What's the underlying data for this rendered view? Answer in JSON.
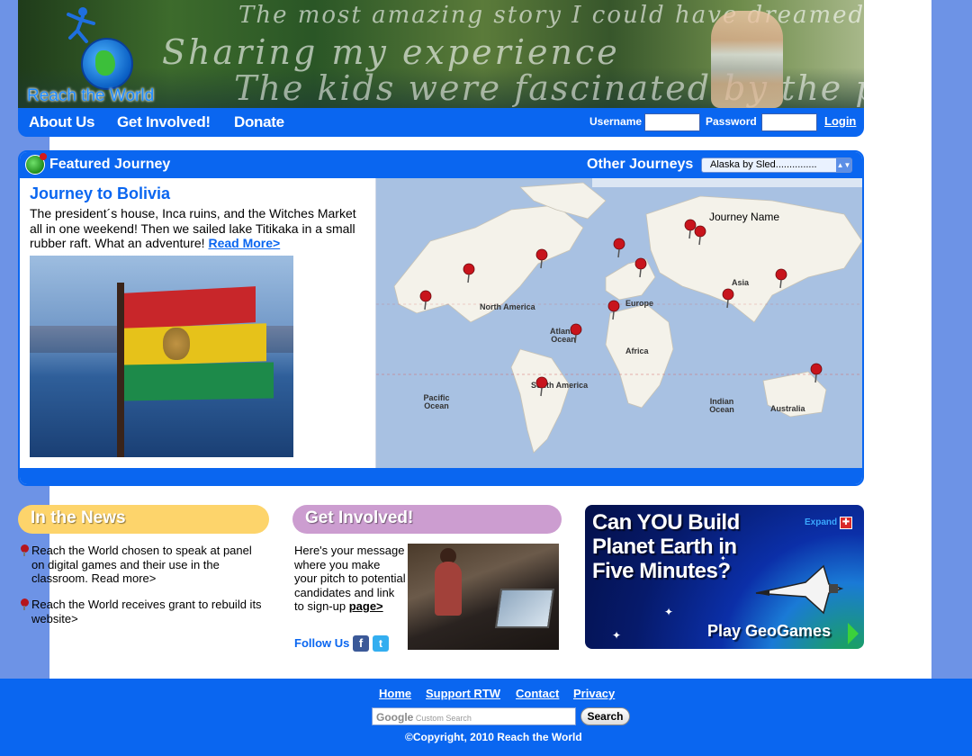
{
  "header": {
    "logo_text": "Reach the World",
    "banner_line1": "The most amazing story I could have dreamed of",
    "banner_line2": "Sharing my experience",
    "banner_line3": "The kids were fascinated by the person"
  },
  "nav": {
    "about": "About Us",
    "involved": "Get Involved!",
    "donate": "Donate",
    "username_label": "Username",
    "password_label": "Password",
    "login_label": "Login",
    "username_value": "",
    "password_value": ""
  },
  "featured": {
    "section_title": "Featured Journey",
    "other_title": "Other Journeys",
    "journey_select_value": "Alaska by Sled...............",
    "journey_heading": "Journey to Bolivia",
    "journey_text": "The president´s house, Inca ruins, and the Witches Market all in one weekend! Then we sailed lake Titikaka in a small rubber raft. What an adventure!",
    "read_more": "Read More>",
    "map_label_journey": "Journey Name",
    "map_labels": {
      "north_america": "North America",
      "south_america": "South America",
      "europe": "Europe",
      "africa": "Africa",
      "asia": "Asia",
      "australia": "Australia",
      "pacific": "Pacific Ocean",
      "atlantic": "Atlantic Ocean",
      "indian": "Indian Ocean"
    }
  },
  "news": {
    "title": "In the News",
    "items": [
      "Reach the World chosen to speak at panel on digital games and their use in the classroom. Read more>",
      "Reach the World receives grant to rebuild its website>"
    ]
  },
  "involve": {
    "title": "Get Involved!",
    "text": "Here's your message where you make your pitch to potential candidates and link to sign-up",
    "link": "page>",
    "follow": "Follow Us"
  },
  "game": {
    "title_lines": [
      "Can YOU Build",
      "Planet Earth in",
      "Five Minutes?"
    ],
    "expand": "Expand",
    "play": "Play GeoGames"
  },
  "footer": {
    "links": [
      "Home",
      "Support RTW",
      "Contact",
      "Privacy"
    ],
    "search_brand": "Google",
    "search_placeholder": "Custom Search",
    "search_button": "Search",
    "copyright": "©Copyright, 2010 Reach the World"
  },
  "colors": {
    "brand_blue": "#0a66f0",
    "news_yellow": "#fdd46b",
    "involve_purple": "#cc9dd0",
    "page_bg": "#6d93e6"
  }
}
